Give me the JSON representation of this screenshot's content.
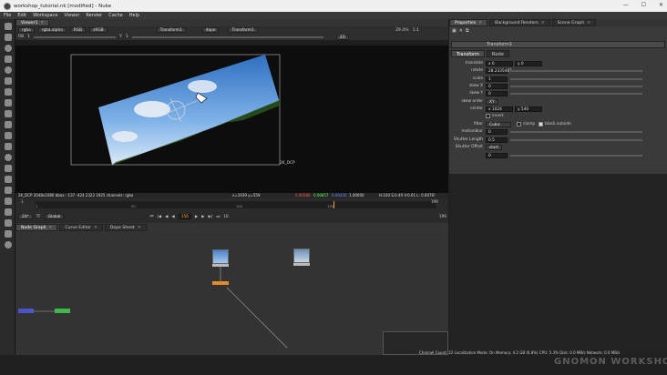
{
  "window": {
    "title": "workshop_tutorial.nk [modified] - Nuke",
    "minimize": "—",
    "maximize": "☐",
    "close": "✕"
  },
  "menu": [
    "File",
    "Edit",
    "Workspace",
    "Viewer",
    "Render",
    "Cache",
    "Help"
  ],
  "viewer_tab": "Viewer1",
  "viewer_controls": {
    "row1": [
      "rgba",
      "rgba.alpha",
      "RGB",
      "sRGB"
    ],
    "input_a": "Transform1",
    "input_b": "dope",
    "input_c": "Transform1",
    "zoom": "29.4%",
    "ratio": "1:1",
    "mode": "2D",
    "frame_left": "f/8",
    "frame_count": "1",
    "y_label": "Y",
    "y_val": "1"
  },
  "viewer_format_label": "2K_DCP",
  "status": {
    "left": "2K_DCP 2048x1080  bbox: -137 -424 2322 1925 channels: rgba",
    "coords": "x=1939 y=559",
    "r": "0.00580",
    "g": "0.00857",
    "b": "0.00430",
    "a": "1.00000",
    "extra": "H:100 S:0.49 V:0.01  L: 0.0076!"
  },
  "timeline": {
    "fps": "24*",
    "tf": "TF",
    "scope": "Global",
    "frame": "156",
    "start": "1",
    "end": "199",
    "ticks": [
      "1",
      "50",
      "100",
      "150"
    ],
    "step": "10"
  },
  "bottom_tabs": [
    "Node Graph",
    "Curve Editor",
    "Dope Sheet"
  ],
  "props_tabs": [
    "Properties",
    "Background Renders",
    "Scene Graph"
  ],
  "props_node": "Transform1",
  "props_subtabs": [
    "Transform",
    "Node"
  ],
  "props_rows": [
    {
      "label": "translate",
      "val1": "x 0",
      "val2": "y 0"
    },
    {
      "label": "rotate",
      "val1": "28.2335461"
    },
    {
      "label": "scale",
      "val1": "1"
    },
    {
      "label": "skew X",
      "val1": "0"
    },
    {
      "label": "skew Y",
      "val1": "0"
    },
    {
      "label": "skew order",
      "val1": "XY"
    },
    {
      "label": "center",
      "val1": "x 1024",
      "val2": "y 540"
    },
    {
      "label": "",
      "val1": "invert"
    },
    {
      "label": "filter",
      "val1": "Cubic",
      "extra1": "clamp",
      "extra2": "black outside"
    },
    {
      "label": "motionblur",
      "val1": "0"
    },
    {
      "label": "Shutter Length",
      "val1": "0.5"
    },
    {
      "label": "Shutter Offset",
      "val1": "start"
    },
    {
      "label": "",
      "val1": "0"
    }
  ],
  "bottom_status": "Channel Count: 22  Localization Mode: On  Memory: 4.2 GB (6.8%)  CPU: 5.3%  Disk: 0.0 MB/s  Network: 0.0 MB/s",
  "watermark": "GNOMON WORKSHOP"
}
